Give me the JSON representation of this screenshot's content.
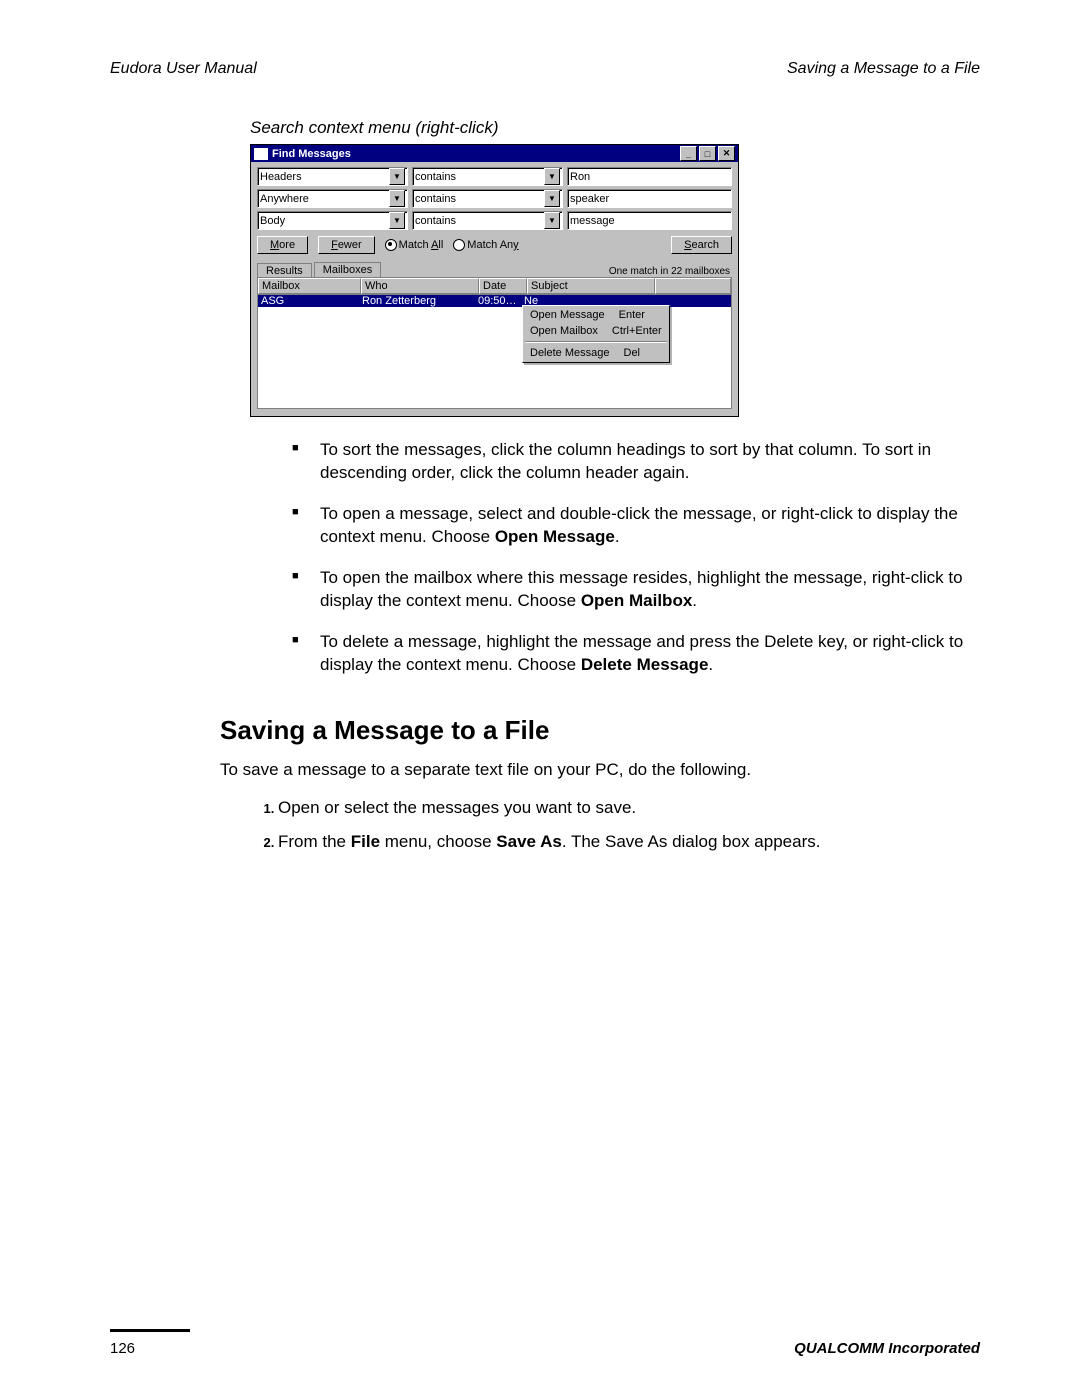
{
  "header": {
    "left": "Eudora User Manual",
    "right": "Saving a Message to a File"
  },
  "caption": "Search context menu (right-click)",
  "fm": {
    "title": "Find Messages",
    "rows": [
      {
        "field": "Headers",
        "op": "contains",
        "value": "Ron"
      },
      {
        "field": "Anywhere",
        "op": "contains",
        "value": "speaker"
      },
      {
        "field": "Body",
        "op": "contains",
        "value": "message"
      }
    ],
    "buttons": {
      "more": "More",
      "fewer": "Fewer",
      "search": "Search"
    },
    "radios": {
      "all": "Match All",
      "any": "Match Any"
    },
    "tabs": {
      "results": "Results",
      "mailboxes": "Mailboxes"
    },
    "status": "One match in 22 mailboxes",
    "cols": {
      "mailbox": "Mailbox",
      "who": "Who",
      "date": "Date",
      "subject": "Subject"
    },
    "result": {
      "mailbox": "ASG",
      "who": "Ron Zetterberg",
      "date": "09:50…",
      "subject": "Ne"
    },
    "menu": {
      "open_msg": "Open Message",
      "open_msg_k": "Enter",
      "open_mbx": "Open Mailbox",
      "open_mbx_k": "Ctrl+Enter",
      "del_msg": "Delete Message",
      "del_msg_k": "Del"
    }
  },
  "bullets": {
    "b1a": "To sort the messages, click the column headings to sort by that column. To sort in descending order, click the column header again.",
    "b2a": "To open a message, select and double-click the message, or right-click to display the context menu. Choose ",
    "b2b": "Open Message",
    "b2c": ".",
    "b3a": "To open the mailbox where this message resides, highlight the message, right-click to display the context menu. Choose ",
    "b3b": "Open Mailbox",
    "b3c": ".",
    "b4a": "To delete a message, highlight the message and press the Delete key, or right-click to display the context menu. Choose ",
    "b4b": "Delete Message",
    "b4c": "."
  },
  "section_heading": "Saving a Message to a File",
  "intro_para": "To save a message to a separate text file on your PC, do the following.",
  "steps": {
    "s1": "Open or select the messages you want to save.",
    "s2a": "From the ",
    "s2b": "File",
    "s2c": " menu, choose ",
    "s2d": "Save As",
    "s2e": ". The Save As dialog box appears."
  },
  "footer": {
    "page": "126",
    "company": "QUALCOMM Incorporated"
  }
}
